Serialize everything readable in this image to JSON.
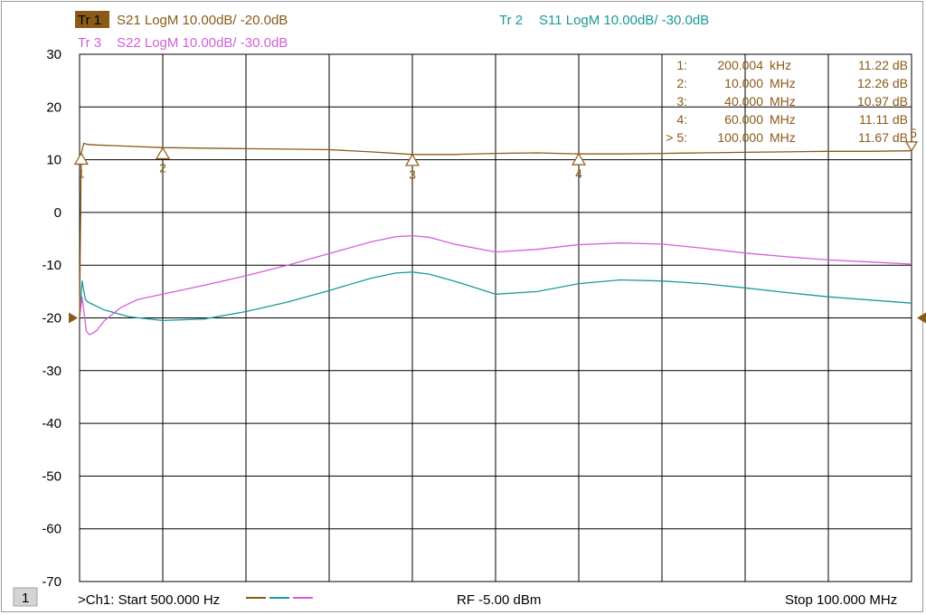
{
  "colors": {
    "tr1": "#8a5a18",
    "tr2": "#1a9a98",
    "tr3": "#d35fd8",
    "grid": "#000000",
    "background": "#ffffff"
  },
  "traces": [
    {
      "id": "tr1",
      "badge": "Tr 1",
      "label": "S21 LogM 10.00dB/  -20.0dB",
      "active": true
    },
    {
      "id": "tr2",
      "badge": "Tr 2",
      "label": "S11 LogM 10.00dB/  -30.0dB",
      "active": false
    },
    {
      "id": "tr3",
      "badge": "Tr 3",
      "label": "S22 LogM 10.00dB/  -30.0dB",
      "active": false
    }
  ],
  "marker_table": [
    {
      "num": "1:",
      "freq": "200.004",
      "unit": "kHz",
      "value": "11.22 dB"
    },
    {
      "num": "2:",
      "freq": "10.000",
      "unit": "MHz",
      "value": "12.26 dB"
    },
    {
      "num": "3:",
      "freq": "40.000",
      "unit": "MHz",
      "value": "10.97 dB"
    },
    {
      "num": "4:",
      "freq": "60.000",
      "unit": "MHz",
      "value": "11.11 dB"
    },
    {
      "num": "> 5:",
      "freq": "100.000",
      "unit": "MHz",
      "value": "11.67 dB"
    }
  ],
  "footer": {
    "channel_badge": "1",
    "start_label": ">Ch1:  Start   500.000 Hz",
    "rf_label": "RF   -5.00 dBm",
    "stop_label": "Stop   100.000 MHz"
  },
  "chart_data": {
    "type": "line",
    "title": "",
    "xlabel": "",
    "ylabel": "",
    "xlim": [
      0.0005,
      100
    ],
    "x_unit": "MHz",
    "ylim": [
      -70,
      30
    ],
    "ytick_labels": [
      "30",
      "20",
      "10",
      "0",
      "-10",
      "-20",
      "-30",
      "-40",
      "-50",
      "-60",
      "-70"
    ],
    "ytick_values": [
      30,
      20,
      10,
      0,
      -10,
      -20,
      -30,
      -40,
      -50,
      -60,
      -70
    ],
    "x_divisions": 10,
    "grid": true,
    "reference_markers": [
      {
        "trace": "tr1",
        "y": -20
      },
      {
        "trace": "tr1",
        "y": -20,
        "side": "right"
      }
    ],
    "series": [
      {
        "name": "S21",
        "color_key": "tr1",
        "x": [
          0.0005,
          0.2,
          0.5,
          1,
          2,
          5,
          10,
          15,
          20,
          25,
          30,
          35,
          40,
          45,
          50,
          55,
          60,
          65,
          70,
          75,
          80,
          85,
          90,
          95,
          100
        ],
        "y": [
          -20,
          11.2,
          13.1,
          12.9,
          12.8,
          12.6,
          12.3,
          12.2,
          12.1,
          12.0,
          11.9,
          11.5,
          11.0,
          11.0,
          11.2,
          11.3,
          11.1,
          11.1,
          11.2,
          11.3,
          11.4,
          11.5,
          11.6,
          11.6,
          11.7
        ]
      },
      {
        "name": "S11",
        "color_key": "tr2",
        "x": [
          0.0005,
          0.3,
          0.7,
          1,
          3,
          6,
          10,
          15,
          20,
          25,
          30,
          35,
          38,
          40,
          42,
          45,
          50,
          55,
          60,
          65,
          70,
          75,
          80,
          85,
          90,
          95,
          100
        ],
        "y": [
          -20,
          -13,
          -16.5,
          -17,
          -18.5,
          -19.8,
          -20.5,
          -20.2,
          -18.8,
          -17,
          -14.8,
          -12.5,
          -11.5,
          -11.3,
          -11.7,
          -13,
          -15.5,
          -15,
          -13.5,
          -12.8,
          -13,
          -13.5,
          -14.3,
          -15.2,
          -16,
          -16.6,
          -17.2
        ]
      },
      {
        "name": "S22",
        "color_key": "tr3",
        "x": [
          0.0005,
          0.3,
          0.8,
          1.2,
          2,
          3,
          5,
          7,
          10,
          15,
          20,
          25,
          30,
          35,
          38,
          40,
          42,
          45,
          50,
          55,
          60,
          65,
          70,
          75,
          80,
          85,
          90,
          95,
          100
        ],
        "y": [
          -20,
          -16,
          -22.5,
          -23.2,
          -22.5,
          -20.5,
          -18,
          -16.5,
          -15.5,
          -13.8,
          -12,
          -10,
          -7.8,
          -5.6,
          -4.6,
          -4.4,
          -4.7,
          -6,
          -7.5,
          -7,
          -6.1,
          -5.8,
          -6,
          -6.8,
          -7.7,
          -8.4,
          -9,
          -9.4,
          -9.8
        ]
      }
    ],
    "markers": [
      {
        "label": "1",
        "trace": "tr1",
        "x": 0.2,
        "y": 11.22
      },
      {
        "label": "2",
        "trace": "tr1",
        "x": 10,
        "y": 12.26
      },
      {
        "label": "3",
        "trace": "tr1",
        "x": 40,
        "y": 10.97
      },
      {
        "label": "4",
        "trace": "tr1",
        "x": 60,
        "y": 11.11
      },
      {
        "label": "5",
        "trace": "tr1",
        "x": 100,
        "y": 11.67,
        "active": true
      }
    ]
  }
}
